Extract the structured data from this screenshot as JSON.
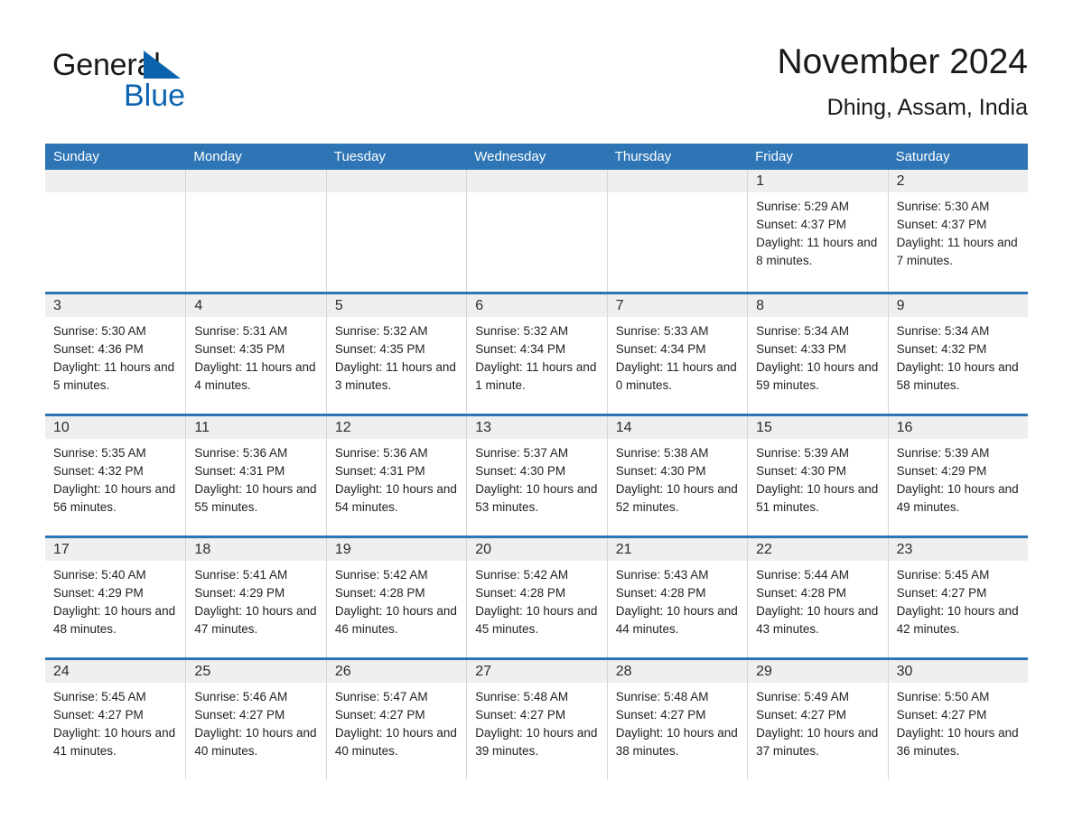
{
  "brand": {
    "name_part1": "General",
    "name_part2": "Blue",
    "flag_icon": "triangle-flag-icon",
    "accent_color": "#0b63b0"
  },
  "header": {
    "title": "November 2024",
    "location": "Dhing, Assam, India"
  },
  "colors": {
    "header_blue": "#2e75b5",
    "day_band_gray": "#efefef",
    "cell_divider": "#d6d6d6",
    "text": "#222222"
  },
  "weekdays": [
    "Sunday",
    "Monday",
    "Tuesday",
    "Wednesday",
    "Thursday",
    "Friday",
    "Saturday"
  ],
  "weeks": [
    [
      {
        "day": "",
        "empty": true
      },
      {
        "day": "",
        "empty": true
      },
      {
        "day": "",
        "empty": true
      },
      {
        "day": "",
        "empty": true
      },
      {
        "day": "",
        "empty": true
      },
      {
        "day": "1",
        "sunrise": "Sunrise: 5:29 AM",
        "sunset": "Sunset: 4:37 PM",
        "daylight": "Daylight: 11 hours and 8 minutes."
      },
      {
        "day": "2",
        "sunrise": "Sunrise: 5:30 AM",
        "sunset": "Sunset: 4:37 PM",
        "daylight": "Daylight: 11 hours and 7 minutes."
      }
    ],
    [
      {
        "day": "3",
        "sunrise": "Sunrise: 5:30 AM",
        "sunset": "Sunset: 4:36 PM",
        "daylight": "Daylight: 11 hours and 5 minutes."
      },
      {
        "day": "4",
        "sunrise": "Sunrise: 5:31 AM",
        "sunset": "Sunset: 4:35 PM",
        "daylight": "Daylight: 11 hours and 4 minutes."
      },
      {
        "day": "5",
        "sunrise": "Sunrise: 5:32 AM",
        "sunset": "Sunset: 4:35 PM",
        "daylight": "Daylight: 11 hours and 3 minutes."
      },
      {
        "day": "6",
        "sunrise": "Sunrise: 5:32 AM",
        "sunset": "Sunset: 4:34 PM",
        "daylight": "Daylight: 11 hours and 1 minute."
      },
      {
        "day": "7",
        "sunrise": "Sunrise: 5:33 AM",
        "sunset": "Sunset: 4:34 PM",
        "daylight": "Daylight: 11 hours and 0 minutes."
      },
      {
        "day": "8",
        "sunrise": "Sunrise: 5:34 AM",
        "sunset": "Sunset: 4:33 PM",
        "daylight": "Daylight: 10 hours and 59 minutes."
      },
      {
        "day": "9",
        "sunrise": "Sunrise: 5:34 AM",
        "sunset": "Sunset: 4:32 PM",
        "daylight": "Daylight: 10 hours and 58 minutes."
      }
    ],
    [
      {
        "day": "10",
        "sunrise": "Sunrise: 5:35 AM",
        "sunset": "Sunset: 4:32 PM",
        "daylight": "Daylight: 10 hours and 56 minutes."
      },
      {
        "day": "11",
        "sunrise": "Sunrise: 5:36 AM",
        "sunset": "Sunset: 4:31 PM",
        "daylight": "Daylight: 10 hours and 55 minutes."
      },
      {
        "day": "12",
        "sunrise": "Sunrise: 5:36 AM",
        "sunset": "Sunset: 4:31 PM",
        "daylight": "Daylight: 10 hours and 54 minutes."
      },
      {
        "day": "13",
        "sunrise": "Sunrise: 5:37 AM",
        "sunset": "Sunset: 4:30 PM",
        "daylight": "Daylight: 10 hours and 53 minutes."
      },
      {
        "day": "14",
        "sunrise": "Sunrise: 5:38 AM",
        "sunset": "Sunset: 4:30 PM",
        "daylight": "Daylight: 10 hours and 52 minutes."
      },
      {
        "day": "15",
        "sunrise": "Sunrise: 5:39 AM",
        "sunset": "Sunset: 4:30 PM",
        "daylight": "Daylight: 10 hours and 51 minutes."
      },
      {
        "day": "16",
        "sunrise": "Sunrise: 5:39 AM",
        "sunset": "Sunset: 4:29 PM",
        "daylight": "Daylight: 10 hours and 49 minutes."
      }
    ],
    [
      {
        "day": "17",
        "sunrise": "Sunrise: 5:40 AM",
        "sunset": "Sunset: 4:29 PM",
        "daylight": "Daylight: 10 hours and 48 minutes."
      },
      {
        "day": "18",
        "sunrise": "Sunrise: 5:41 AM",
        "sunset": "Sunset: 4:29 PM",
        "daylight": "Daylight: 10 hours and 47 minutes."
      },
      {
        "day": "19",
        "sunrise": "Sunrise: 5:42 AM",
        "sunset": "Sunset: 4:28 PM",
        "daylight": "Daylight: 10 hours and 46 minutes."
      },
      {
        "day": "20",
        "sunrise": "Sunrise: 5:42 AM",
        "sunset": "Sunset: 4:28 PM",
        "daylight": "Daylight: 10 hours and 45 minutes."
      },
      {
        "day": "21",
        "sunrise": "Sunrise: 5:43 AM",
        "sunset": "Sunset: 4:28 PM",
        "daylight": "Daylight: 10 hours and 44 minutes."
      },
      {
        "day": "22",
        "sunrise": "Sunrise: 5:44 AM",
        "sunset": "Sunset: 4:28 PM",
        "daylight": "Daylight: 10 hours and 43 minutes."
      },
      {
        "day": "23",
        "sunrise": "Sunrise: 5:45 AM",
        "sunset": "Sunset: 4:27 PM",
        "daylight": "Daylight: 10 hours and 42 minutes."
      }
    ],
    [
      {
        "day": "24",
        "sunrise": "Sunrise: 5:45 AM",
        "sunset": "Sunset: 4:27 PM",
        "daylight": "Daylight: 10 hours and 41 minutes."
      },
      {
        "day": "25",
        "sunrise": "Sunrise: 5:46 AM",
        "sunset": "Sunset: 4:27 PM",
        "daylight": "Daylight: 10 hours and 40 minutes."
      },
      {
        "day": "26",
        "sunrise": "Sunrise: 5:47 AM",
        "sunset": "Sunset: 4:27 PM",
        "daylight": "Daylight: 10 hours and 40 minutes."
      },
      {
        "day": "27",
        "sunrise": "Sunrise: 5:48 AM",
        "sunset": "Sunset: 4:27 PM",
        "daylight": "Daylight: 10 hours and 39 minutes."
      },
      {
        "day": "28",
        "sunrise": "Sunrise: 5:48 AM",
        "sunset": "Sunset: 4:27 PM",
        "daylight": "Daylight: 10 hours and 38 minutes."
      },
      {
        "day": "29",
        "sunrise": "Sunrise: 5:49 AM",
        "sunset": "Sunset: 4:27 PM",
        "daylight": "Daylight: 10 hours and 37 minutes."
      },
      {
        "day": "30",
        "sunrise": "Sunrise: 5:50 AM",
        "sunset": "Sunset: 4:27 PM",
        "daylight": "Daylight: 10 hours and 36 minutes."
      }
    ]
  ]
}
